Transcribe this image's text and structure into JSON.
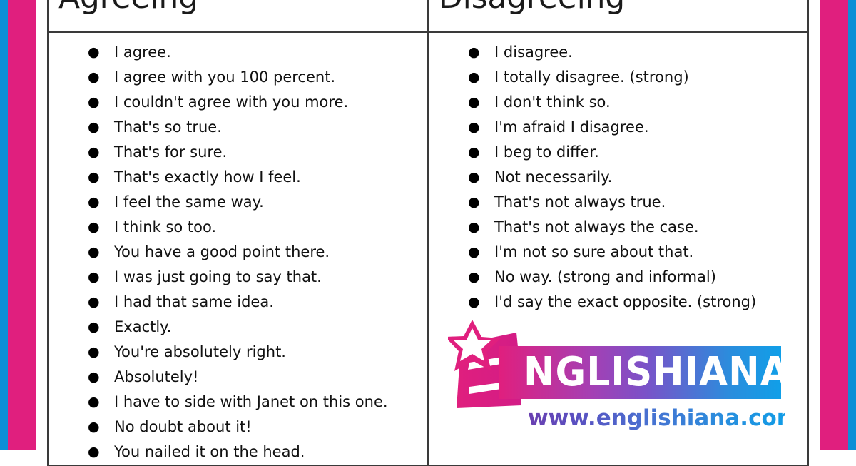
{
  "page": {
    "background_color": "#ffffff",
    "edge_stripes": {
      "blue": "#0b8fd6",
      "pink": "#e01f7e"
    },
    "table_border_color": "#3a3a3a"
  },
  "table": {
    "columns": [
      {
        "key": "agreeing",
        "header": "Agreeing",
        "items": [
          "I agree.",
          "I agree with you 100 percent.",
          "I couldn't agree with you more.",
          "That's so true.",
          "That's for sure.",
          "That's exactly how I feel.",
          "I feel the same way.",
          "I think so too.",
          "You have a good point there.",
          "I was just going to say that.",
          "I had that same idea.",
          "Exactly.",
          "You're absolutely right.",
          "Absolutely!",
          "I have to side with Janet on this one.",
          "No doubt about it!",
          "You nailed it on the head."
        ]
      },
      {
        "key": "disagreeing",
        "header": "Disagreeing",
        "items": [
          "I disagree.",
          "I totally disagree. (strong)",
          "I don't think so.",
          "I'm afraid I disagree.",
          "I beg to differ.",
          "Not necessarily.",
          "That's not always true.",
          "That's not always the case.",
          "I'm not so sure about that.",
          "No way. (strong and informal)",
          "I'd say the exact opposite. (strong)"
        ]
      }
    ],
    "bullet_glyph": "●"
  },
  "logo": {
    "wordmark_lead_letter": "E",
    "wordmark_rest": "NGLISHIANA",
    "url": "www.englishiana.com",
    "star_color": "#ffffff",
    "e_color": "#e01f7e",
    "gradient_start": "#e01f7e",
    "gradient_end": "#109fe8",
    "url_gradient_start": "#6a3fb0",
    "url_gradient_end": "#119ce6"
  }
}
